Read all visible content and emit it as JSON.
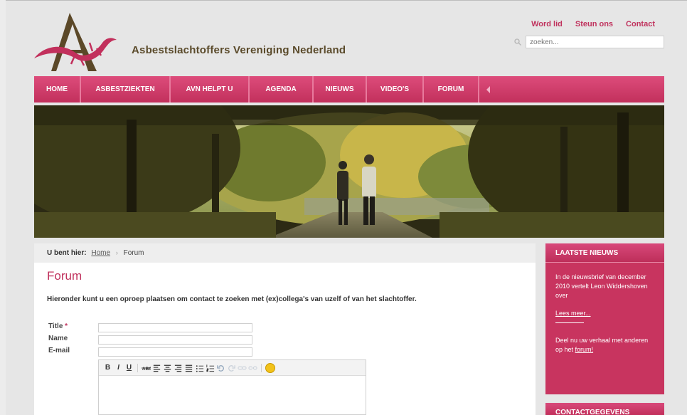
{
  "header": {
    "site_title": "Asbestslachtoffers Vereniging Nederland",
    "top_links": [
      "Word lid",
      "Steun ons",
      "Contact"
    ],
    "search_placeholder": "zoeken..."
  },
  "nav": {
    "items": [
      "HOME",
      "ASBESTZIEKTEN",
      "AVN HELPT U",
      "AGENDA",
      "NIEUWS",
      "VIDEO'S",
      "FORUM"
    ]
  },
  "breadcrumb": {
    "label": "U bent hier:",
    "home": "Home",
    "separator": "›",
    "current": "Forum"
  },
  "main": {
    "title": "Forum",
    "intro": "Hieronder kunt u een oproep plaatsen om contact te zoeken met (ex)collega's van uzelf of van het slachtoffer.",
    "fields": {
      "title_label": "Title",
      "required_mark": "*",
      "name_label": "Name",
      "email_label": "E-mail"
    },
    "toolbar": {
      "bold": "B",
      "italic": "I",
      "underline": "U"
    }
  },
  "sidebar": {
    "news_heading": "LAATSTE NIEUWS",
    "news_text": "In de nieuwsbrief van december 2010 vertelt Leon Widdershoven over",
    "read_more": "Lees meer...",
    "share_text": "Deel nu uw verhaal met anderen op het",
    "share_link": "forum!",
    "contact_heading": "CONTACTGEGEVENS"
  },
  "colors": {
    "brand": "#c8345f",
    "nav_top": "#dd4c7b",
    "title_text": "#5a4a2a"
  }
}
